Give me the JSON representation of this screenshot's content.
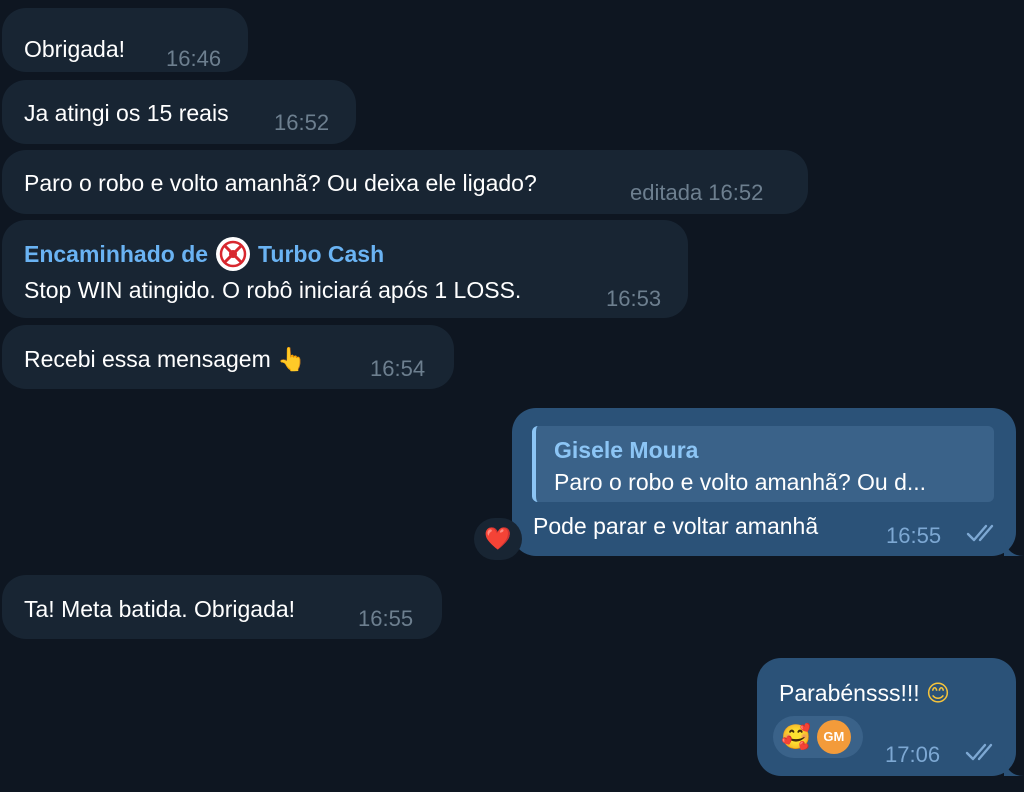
{
  "messages": [
    {
      "text": "Obrigada!",
      "time": "16:46"
    },
    {
      "text": "Ja atingi os 15 reais",
      "time": "16:52"
    },
    {
      "text": "Paro o robo e volto amanhã? Ou deixa ele ligado?",
      "time": "editada 16:52"
    },
    {
      "forward_prefix": "Encaminhado de",
      "forward_source": "Turbo Cash",
      "text": "Stop WIN atingido. O robô iniciará após 1 LOSS.",
      "time": "16:53"
    },
    {
      "text": "Recebi essa mensagem",
      "emoji": "👆",
      "time": "16:54"
    },
    {
      "reply_name": "Gisele Moura",
      "reply_text": "Paro o robo e volto amanhã? Ou d...",
      "text": "Pode parar e voltar amanhã",
      "time": "16:55",
      "reaction": "❤️"
    },
    {
      "text": "Ta! Meta batida. Obrigada!",
      "time": "16:55"
    },
    {
      "text": "Parabénsss!!!",
      "emoji": "😊",
      "time": "17:06",
      "reaction": "🥰",
      "reactor_initials": "GM"
    }
  ],
  "colors": {
    "background": "#0e1621",
    "incoming_bubble": "#182533",
    "outgoing_bubble": "#2b5278",
    "accent": "#6ab3f3",
    "read_checks": "#7da8d3"
  },
  "icons": {
    "read_receipt": "double-check-icon",
    "forward_source_avatar": "turbo-cash-logo-icon",
    "reactor_avatar": "user-avatar"
  }
}
